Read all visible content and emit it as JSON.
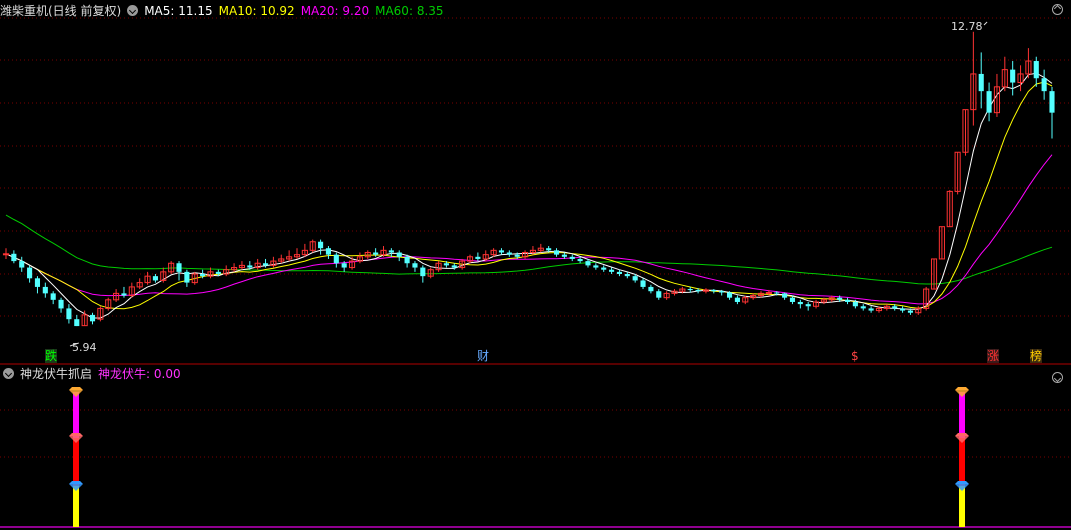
{
  "header": {
    "title": "潍柴重机(日线 前复权)",
    "ma": [
      {
        "label": "MA5:",
        "value": "11.15",
        "color": "#ffffff"
      },
      {
        "label": "MA10:",
        "value": "10.92",
        "color": "#ffff00"
      },
      {
        "label": "MA20:",
        "value": "9.20",
        "color": "#ff00ff"
      },
      {
        "label": "MA60:",
        "value": "8.35",
        "color": "#00cc00"
      }
    ]
  },
  "indicator": {
    "title": "神龙伏牛抓启",
    "value_label": "神龙伏牛:",
    "value": "0.00",
    "color": "#ff33ff"
  },
  "annotations": {
    "high_label": "12.78",
    "low_label": "5.94"
  },
  "markers": [
    {
      "text": "跌",
      "color": "#00ff00",
      "bg": "#1a3a1a"
    },
    {
      "text": "财",
      "color": "#66aaff",
      "bg": ""
    },
    {
      "text": "$",
      "color": "#ff4444",
      "bg": ""
    },
    {
      "text": "涨",
      "color": "#ff3333",
      "bg": "#3a1a1a"
    },
    {
      "text": "榜",
      "color": "#ffcc00",
      "bg": "#3a2a10"
    }
  ],
  "colors": {
    "up": "#ff3333",
    "down": "#54ffff",
    "ma5": "#ffffff",
    "ma10": "#ffff00",
    "ma20": "#ff00ff",
    "ma60": "#00cc00",
    "grid": "#7a0000",
    "axis": "#b00000"
  },
  "chart_data": {
    "type": "candlestick",
    "price_range": [
      5.5,
      13.1
    ],
    "candles": [
      [
        7.6,
        7.62,
        7.75,
        7.5
      ],
      [
        7.62,
        7.45,
        7.7,
        7.4
      ],
      [
        7.45,
        7.3,
        7.55,
        7.2
      ],
      [
        7.3,
        7.05,
        7.35,
        6.95
      ],
      [
        7.05,
        6.85,
        7.1,
        6.7
      ],
      [
        6.85,
        6.7,
        6.95,
        6.6
      ],
      [
        6.7,
        6.55,
        6.75,
        6.45
      ],
      [
        6.55,
        6.35,
        6.6,
        6.25
      ],
      [
        6.35,
        6.1,
        6.45,
        6.0
      ],
      [
        6.1,
        5.94,
        6.2,
        5.94
      ],
      [
        5.95,
        6.2,
        6.3,
        5.95
      ],
      [
        6.2,
        6.05,
        6.25,
        5.98
      ],
      [
        6.1,
        6.35,
        6.4,
        6.05
      ],
      [
        6.35,
        6.55,
        6.6,
        6.3
      ],
      [
        6.55,
        6.7,
        6.8,
        6.5
      ],
      [
        6.7,
        6.65,
        6.85,
        6.6
      ],
      [
        6.65,
        6.85,
        6.95,
        6.6
      ],
      [
        6.85,
        6.95,
        7.05,
        6.8
      ],
      [
        6.95,
        7.1,
        7.2,
        6.9
      ],
      [
        7.1,
        7.0,
        7.15,
        6.95
      ],
      [
        7.0,
        7.2,
        7.3,
        6.95
      ],
      [
        7.2,
        7.4,
        7.45,
        7.15
      ],
      [
        7.4,
        7.2,
        7.45,
        7.0
      ],
      [
        7.2,
        6.95,
        7.25,
        6.85
      ],
      [
        6.95,
        7.15,
        7.2,
        6.9
      ],
      [
        7.15,
        7.1,
        7.25,
        7.05
      ],
      [
        7.1,
        7.2,
        7.3,
        7.05
      ],
      [
        7.2,
        7.15,
        7.25,
        7.1
      ],
      [
        7.15,
        7.25,
        7.35,
        7.1
      ],
      [
        7.25,
        7.3,
        7.4,
        7.2
      ],
      [
        7.3,
        7.35,
        7.45,
        7.25
      ],
      [
        7.35,
        7.3,
        7.45,
        7.25
      ],
      [
        7.3,
        7.4,
        7.5,
        7.25
      ],
      [
        7.4,
        7.35,
        7.5,
        7.3
      ],
      [
        7.35,
        7.45,
        7.55,
        7.3
      ],
      [
        7.45,
        7.5,
        7.6,
        7.4
      ],
      [
        7.5,
        7.55,
        7.7,
        7.45
      ],
      [
        7.55,
        7.6,
        7.75,
        7.5
      ],
      [
        7.6,
        7.7,
        7.85,
        7.55
      ],
      [
        7.7,
        7.9,
        7.95,
        7.65
      ],
      [
        7.9,
        7.75,
        7.95,
        7.6
      ],
      [
        7.75,
        7.6,
        7.8,
        7.5
      ],
      [
        7.6,
        7.4,
        7.65,
        7.3
      ],
      [
        7.4,
        7.3,
        7.45,
        7.2
      ],
      [
        7.3,
        7.45,
        7.55,
        7.25
      ],
      [
        7.45,
        7.55,
        7.65,
        7.4
      ],
      [
        7.55,
        7.65,
        7.7,
        7.5
      ],
      [
        7.65,
        7.6,
        7.75,
        7.55
      ],
      [
        7.6,
        7.7,
        7.8,
        7.55
      ],
      [
        7.7,
        7.65,
        7.75,
        7.55
      ],
      [
        7.65,
        7.55,
        7.7,
        7.45
      ],
      [
        7.55,
        7.4,
        7.6,
        7.3
      ],
      [
        7.4,
        7.3,
        7.45,
        7.2
      ],
      [
        7.3,
        7.1,
        7.35,
        6.95
      ],
      [
        7.1,
        7.25,
        7.3,
        7.05
      ],
      [
        7.25,
        7.4,
        7.45,
        7.2
      ],
      [
        7.4,
        7.35,
        7.45,
        7.3
      ],
      [
        7.35,
        7.3,
        7.4,
        7.25
      ],
      [
        7.3,
        7.45,
        7.5,
        7.25
      ],
      [
        7.45,
        7.55,
        7.6,
        7.4
      ],
      [
        7.55,
        7.5,
        7.65,
        7.45
      ],
      [
        7.5,
        7.6,
        7.7,
        7.45
      ],
      [
        7.6,
        7.7,
        7.75,
        7.55
      ],
      [
        7.7,
        7.65,
        7.75,
        7.6
      ],
      [
        7.65,
        7.6,
        7.7,
        7.55
      ],
      [
        7.6,
        7.55,
        7.65,
        7.5
      ],
      [
        7.55,
        7.65,
        7.7,
        7.5
      ],
      [
        7.65,
        7.7,
        7.8,
        7.6
      ],
      [
        7.7,
        7.75,
        7.85,
        7.65
      ],
      [
        7.75,
        7.7,
        7.8,
        7.65
      ],
      [
        7.7,
        7.6,
        7.75,
        7.55
      ],
      [
        7.6,
        7.55,
        7.65,
        7.5
      ],
      [
        7.55,
        7.5,
        7.6,
        7.45
      ],
      [
        7.5,
        7.45,
        7.55,
        7.4
      ],
      [
        7.45,
        7.35,
        7.5,
        7.3
      ],
      [
        7.35,
        7.3,
        7.4,
        7.25
      ],
      [
        7.3,
        7.25,
        7.35,
        7.2
      ],
      [
        7.25,
        7.2,
        7.3,
        7.15
      ],
      [
        7.2,
        7.15,
        7.25,
        7.1
      ],
      [
        7.15,
        7.1,
        7.2,
        7.05
      ],
      [
        7.1,
        7.0,
        7.15,
        6.95
      ],
      [
        7.0,
        6.85,
        7.05,
        6.8
      ],
      [
        6.85,
        6.75,
        6.9,
        6.7
      ],
      [
        6.75,
        6.6,
        6.8,
        6.55
      ],
      [
        6.6,
        6.7,
        6.75,
        6.55
      ],
      [
        6.7,
        6.75,
        6.8,
        6.65
      ],
      [
        6.75,
        6.8,
        6.85,
        6.7
      ],
      [
        6.8,
        6.78,
        6.85,
        6.72
      ],
      [
        6.78,
        6.75,
        6.82,
        6.7
      ],
      [
        6.75,
        6.78,
        6.82,
        6.7
      ],
      [
        6.78,
        6.75,
        6.8,
        6.7
      ],
      [
        6.75,
        6.72,
        6.78,
        6.65
      ],
      [
        6.72,
        6.6,
        6.75,
        6.55
      ],
      [
        6.6,
        6.5,
        6.65,
        6.45
      ],
      [
        6.5,
        6.6,
        6.65,
        6.45
      ],
      [
        6.6,
        6.65,
        6.7,
        6.55
      ],
      [
        6.65,
        6.7,
        6.75,
        6.6
      ],
      [
        6.7,
        6.72,
        6.78,
        6.65
      ],
      [
        6.72,
        6.7,
        6.75,
        6.65
      ],
      [
        6.7,
        6.6,
        6.72,
        6.55
      ],
      [
        6.6,
        6.5,
        6.65,
        6.45
      ],
      [
        6.5,
        6.45,
        6.55,
        6.35
      ],
      [
        6.45,
        6.4,
        6.5,
        6.3
      ],
      [
        6.4,
        6.5,
        6.55,
        6.35
      ],
      [
        6.5,
        6.55,
        6.6,
        6.45
      ],
      [
        6.55,
        6.6,
        6.65,
        6.5
      ],
      [
        6.6,
        6.55,
        6.65,
        6.5
      ],
      [
        6.55,
        6.5,
        6.6,
        6.45
      ],
      [
        6.5,
        6.4,
        6.55,
        6.35
      ],
      [
        6.4,
        6.35,
        6.45,
        6.3
      ],
      [
        6.35,
        6.3,
        6.4,
        6.25
      ],
      [
        6.3,
        6.35,
        6.4,
        6.25
      ],
      [
        6.35,
        6.4,
        6.45,
        6.3
      ],
      [
        6.4,
        6.35,
        6.45,
        6.3
      ],
      [
        6.35,
        6.3,
        6.4,
        6.25
      ],
      [
        6.3,
        6.25,
        6.35,
        6.2
      ],
      [
        6.25,
        6.35,
        6.4,
        6.2
      ],
      [
        6.35,
        6.8,
        6.85,
        6.3
      ],
      [
        6.8,
        7.5,
        7.5,
        6.8
      ],
      [
        7.5,
        8.25,
        8.25,
        7.5
      ],
      [
        8.25,
        9.07,
        9.1,
        8.25
      ],
      [
        9.07,
        9.98,
        9.98,
        9.0
      ],
      [
        9.98,
        10.97,
        10.97,
        9.9
      ],
      [
        10.97,
        11.8,
        12.78,
        10.6
      ],
      [
        11.8,
        11.4,
        12.3,
        11.0
      ],
      [
        11.4,
        10.9,
        11.6,
        10.7
      ],
      [
        10.9,
        11.5,
        11.8,
        10.8
      ],
      [
        11.5,
        11.9,
        12.2,
        11.4
      ],
      [
        11.9,
        11.6,
        12.1,
        11.3
      ],
      [
        11.6,
        11.8,
        12.0,
        11.4
      ],
      [
        11.8,
        12.1,
        12.4,
        11.7
      ],
      [
        12.1,
        11.7,
        12.2,
        11.5
      ],
      [
        11.7,
        11.4,
        11.9,
        11.2
      ],
      [
        11.4,
        10.9,
        11.5,
        10.3
      ]
    ],
    "signals_idx": [
      9,
      122
    ]
  }
}
